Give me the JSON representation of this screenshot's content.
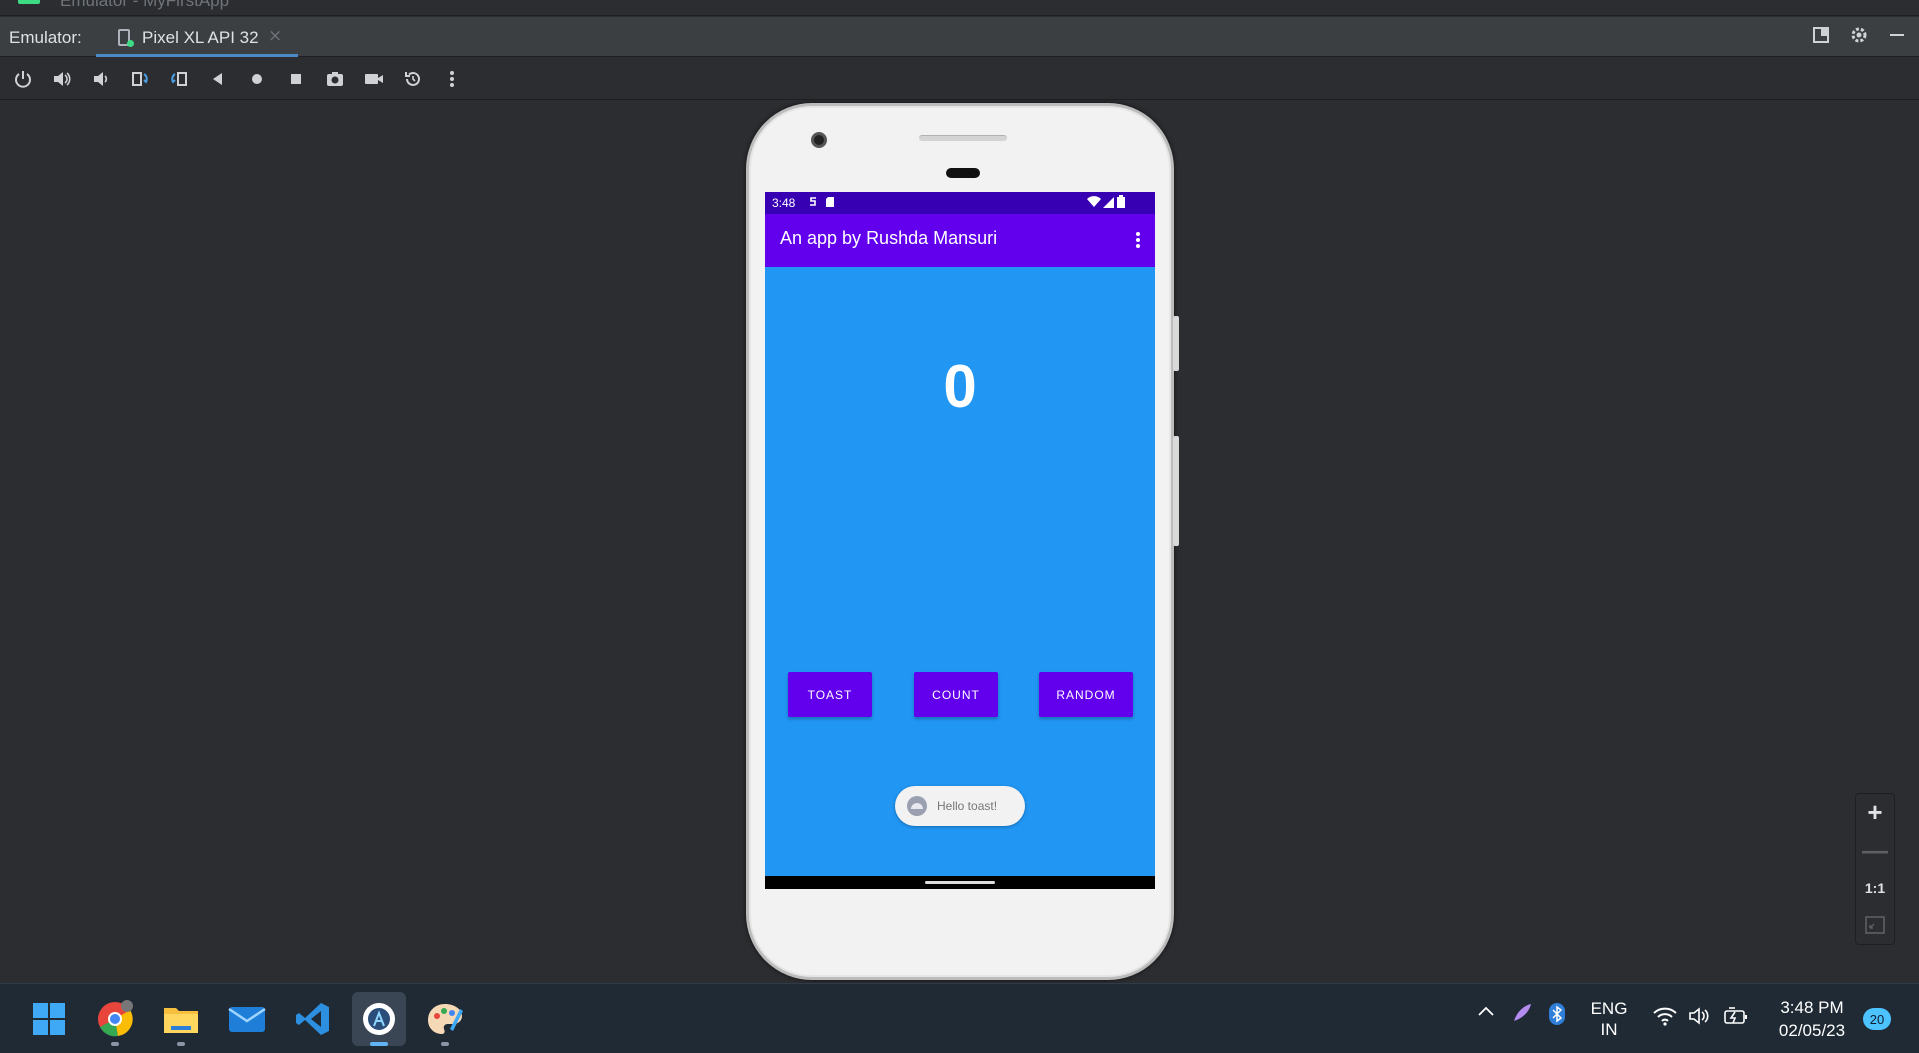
{
  "window": {
    "title": "Emulator - MyFirstApp"
  },
  "tabbar": {
    "label": "Emulator:",
    "tab_title": "Pixel XL API 32",
    "tab_close": "×"
  },
  "toolbar": {
    "items": [
      "power-icon",
      "volume-up-icon",
      "volume-down-icon",
      "rotate-left-icon",
      "rotate-right-icon",
      "back-icon",
      "home-icon",
      "overview-icon",
      "screenshot-icon",
      "screen-record-icon",
      "snapshot-icon",
      "more-icon"
    ]
  },
  "device": {
    "status_time": "3:48",
    "app_title": "An app by Rushda Mansuri",
    "count_value": "0",
    "buttons": {
      "toast": "TOAST",
      "count": "COUNT",
      "random": "RANDOM"
    },
    "toast_message": "Hello toast!",
    "colors": {
      "status_bar": "#3700b3",
      "app_bar": "#6200ee",
      "background": "#2196f3",
      "button": "#6200ee"
    }
  },
  "zoom": {
    "zoom_in": "+",
    "zoom_out": "—",
    "actual_size": "1:1"
  },
  "taskbar": {
    "apps": [
      "start-icon",
      "chrome-icon",
      "file-explorer-icon",
      "mail-icon",
      "vscode-icon",
      "android-studio-icon",
      "paint-icon"
    ],
    "tray": {
      "lang_top": "ENG",
      "lang_bottom": "IN",
      "time": "3:48 PM",
      "date": "02/05/23",
      "notifications": "20"
    }
  }
}
